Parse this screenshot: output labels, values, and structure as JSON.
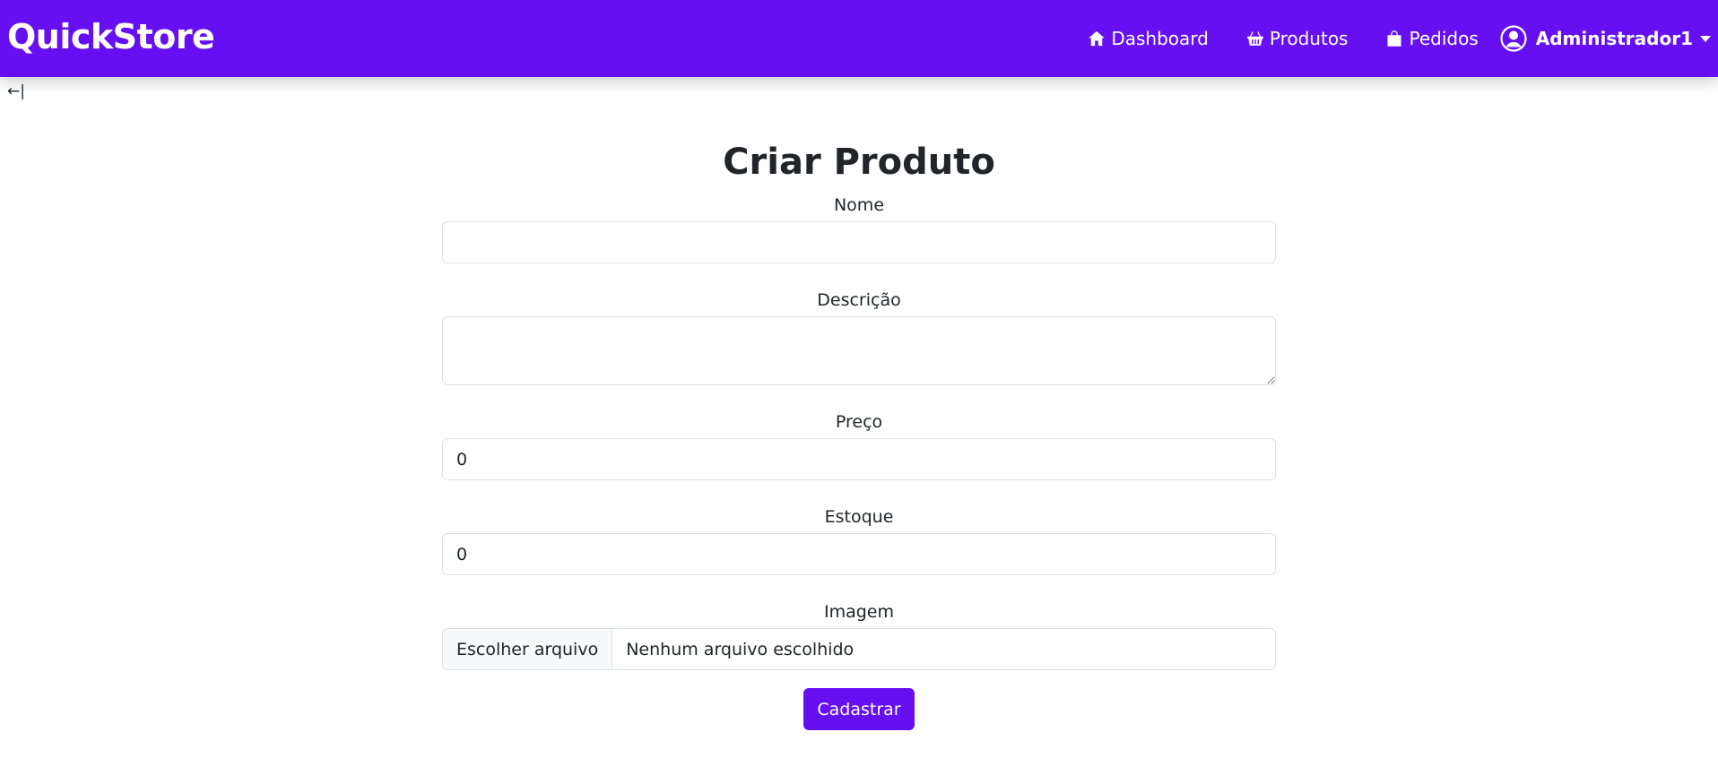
{
  "navbar": {
    "brand": "QuickStore",
    "links": [
      {
        "label": "Dashboard",
        "icon": "house-icon"
      },
      {
        "label": "Produtos",
        "icon": "basket-icon"
      },
      {
        "label": "Pedidos",
        "icon": "bag-icon"
      }
    ],
    "user": {
      "name": "Administrador1",
      "icon": "user-circle-icon"
    },
    "color": "#6610f2"
  },
  "back": {
    "label": "←|"
  },
  "form": {
    "title": "Criar Produto",
    "fields": {
      "nome": {
        "label": "Nome",
        "value": ""
      },
      "descricao": {
        "label": "Descrição",
        "value": ""
      },
      "preco": {
        "label": "Preço",
        "value": "0"
      },
      "estoque": {
        "label": "Estoque",
        "value": "0"
      },
      "imagem": {
        "label": "Imagem",
        "button": "Escolher arquivo",
        "status": "Nenhum arquivo escolhido"
      }
    },
    "submit_label": "Cadastrar"
  }
}
